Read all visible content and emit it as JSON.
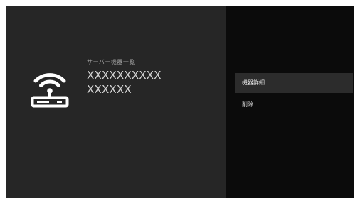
{
  "device": {
    "icon": "wifi-router-icon",
    "caption": "サーバー機器一覧",
    "name_line1": "XXXXXXXXXX",
    "name_line2": "XXXXXX"
  },
  "menu": {
    "items": [
      {
        "label": "機器詳細",
        "focused": true
      },
      {
        "label": "削除",
        "focused": false
      }
    ]
  },
  "colors": {
    "left_panel": "#262626",
    "right_panel": "#0b0b0b",
    "focus_highlight": "#2c2c2c",
    "text_primary": "#d4d4d4",
    "text_secondary": "#9a9a9a"
  }
}
